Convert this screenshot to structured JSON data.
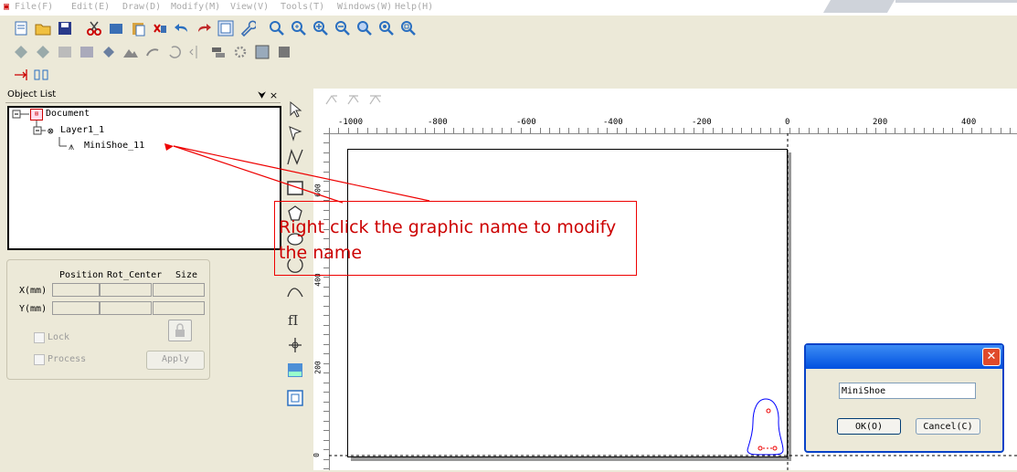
{
  "menu": [
    "File(F)",
    "Edit(E)",
    "Draw(D)",
    "Modify(M)",
    "View(V)",
    "Tools(T)",
    "Windows(W)",
    "Help(H)"
  ],
  "object_list": {
    "title": "Object List",
    "pin": "⮟ ×",
    "tree": {
      "document": "Document",
      "layer": "Layer1_1",
      "shape": "MiniShoe_11"
    }
  },
  "props": {
    "col_position": "Position",
    "col_rot": "Rot_Center",
    "col_size": "Size",
    "row_x": "X(mm)",
    "row_y": "Y(mm)",
    "lock": "Lock",
    "process": "Process",
    "apply": "Apply"
  },
  "ruler": {
    "h_ticks": [
      "-1000",
      "-800",
      "-600",
      "-400",
      "-200",
      "0",
      "200",
      "400"
    ],
    "v_ticks": [
      "600",
      "400",
      "200",
      "0"
    ]
  },
  "callout": "Right click the graphic name to modify the name",
  "dialog": {
    "name_value": "MiniShoe",
    "ok": "OK(O)",
    "cancel": "Cancel(C)"
  }
}
